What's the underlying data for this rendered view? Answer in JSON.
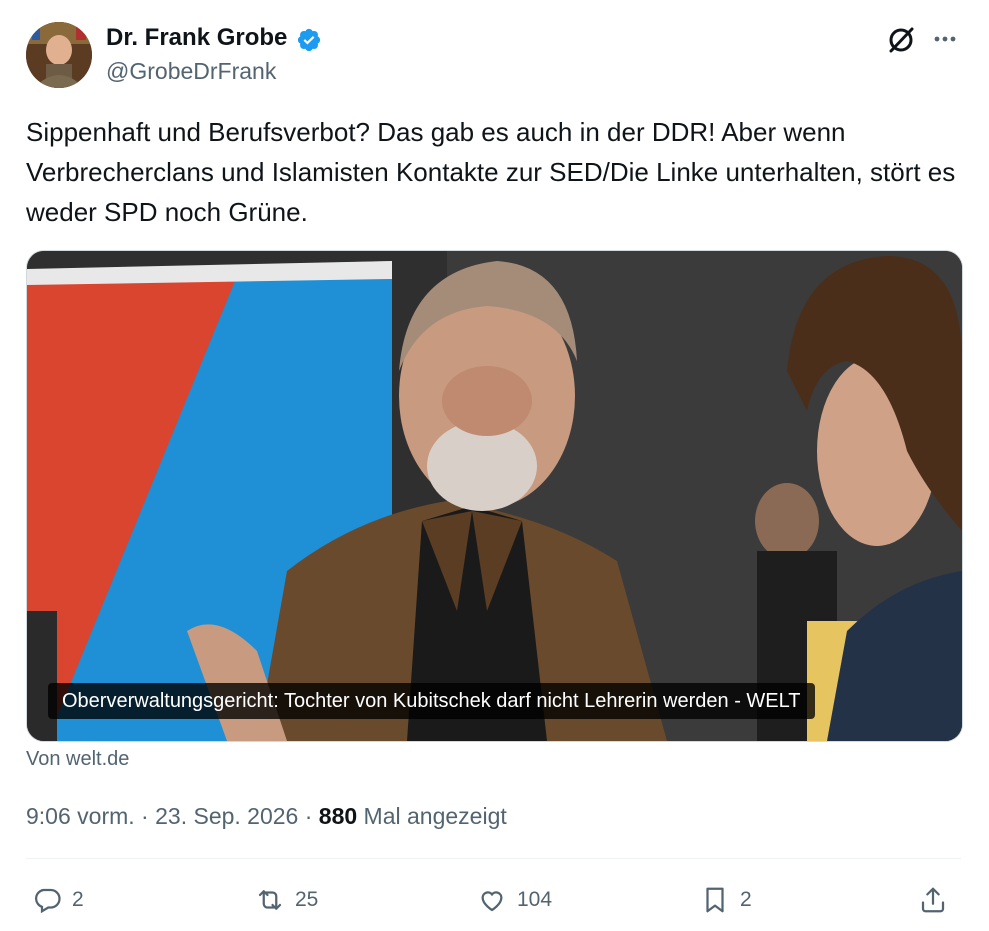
{
  "author": {
    "name": "Dr. Frank Grobe",
    "handle": "@GrobeDrFrank"
  },
  "tweet": {
    "text": "Sippenhaft und Berufsverbot? Das gab es auch in der DDR! Aber wenn Verbrecherclans und Islamisten Kontakte zur SED/Die Linke unterhalten, stört es weder SPD noch Grüne."
  },
  "card": {
    "caption": "Oberverwaltungsgericht: Tochter von Kubitschek darf nicht Lehrerin werden - WELT",
    "source": "Von welt.de"
  },
  "meta": {
    "time": "9:06 vorm.",
    "sep1": " · ",
    "date": "23. Sep. 2026",
    "sep2": " · ",
    "views": "880",
    "views_label": " Mal angezeigt"
  },
  "actions": {
    "replies": "2",
    "reposts": "25",
    "likes": "104",
    "bookmarks": "2"
  },
  "icons": [
    "verified-icon",
    "grok-icon",
    "more-icon",
    "reply-icon",
    "repost-icon",
    "like-icon",
    "bookmark-icon",
    "share-icon"
  ],
  "colors": {
    "verified": "#1d9bf0",
    "text": "#0f1419",
    "muted": "#536471"
  }
}
